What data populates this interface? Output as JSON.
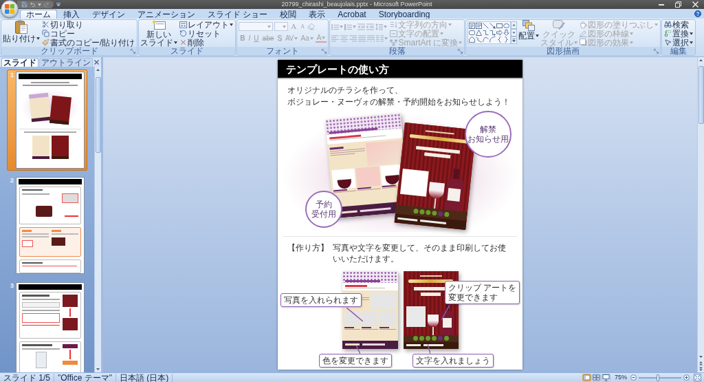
{
  "window": {
    "title": "20799_chirashi_beaujolais.pptx - Microsoft PowerPoint"
  },
  "ribbon_tabs": [
    {
      "label": "ホーム",
      "selected": true
    },
    {
      "label": "挿入",
      "selected": false
    },
    {
      "label": "デザイン",
      "selected": false
    },
    {
      "label": "アニメーション",
      "selected": false
    },
    {
      "label": "スライド ショー",
      "selected": false
    },
    {
      "label": "校閲",
      "selected": false
    },
    {
      "label": "表示",
      "selected": false
    },
    {
      "label": "Acrobat",
      "selected": false
    },
    {
      "label": "Storyboarding",
      "selected": false
    }
  ],
  "ribbon_groups": [
    {
      "kind": "clipboard",
      "label": "クリップボード",
      "launcher": true,
      "large": [
        {
          "lines": [
            "貼り付け"
          ],
          "disabled": false,
          "dropdown": true
        }
      ],
      "items": [
        {
          "label": "切り取り",
          "disabled": false
        },
        {
          "label": "コピー",
          "disabled": false
        },
        {
          "label": "書式のコピー/貼り付け",
          "disabled": false
        }
      ]
    },
    {
      "kind": "slides",
      "label": "スライド",
      "launcher": false,
      "large": [
        {
          "lines": [
            "新しい",
            "スライド"
          ],
          "disabled": false,
          "dropdown": true
        }
      ],
      "items": [
        {
          "label": "レイアウト",
          "disabled": false,
          "dropdown": true
        },
        {
          "label": "リセット",
          "disabled": false,
          "dropdown": false
        },
        {
          "label": "削除",
          "disabled": false,
          "dropdown": false
        }
      ]
    },
    {
      "kind": "font",
      "label": "フォント",
      "launcher": true,
      "disabled": true,
      "size_buttons": [
        "A",
        "A"
      ],
      "style_buttons": [
        "B",
        "I",
        "U",
        "abe",
        "S",
        "AV",
        "Aa",
        "A"
      ]
    },
    {
      "kind": "paragraph",
      "label": "段落",
      "launcher": true,
      "disabled": true,
      "items": [
        {
          "label": "文字列の方向",
          "disabled": true,
          "dropdown": true
        },
        {
          "label": "文字の配置",
          "disabled": true,
          "dropdown": true
        },
        {
          "label": "SmartArt に変換",
          "disabled": true,
          "dropdown": true
        }
      ]
    },
    {
      "kind": "drawing",
      "label": "図形描画",
      "launcher": true,
      "large": [
        {
          "lines": [
            "配置"
          ],
          "disabled": false,
          "dropdown": true
        },
        {
          "lines": [
            "クイック",
            "スタイル"
          ],
          "disabled": true,
          "dropdown": true
        }
      ],
      "items": [
        {
          "label": "図形の塗りつぶし",
          "disabled": true,
          "dropdown": true
        },
        {
          "label": "図形の枠線",
          "disabled": true,
          "dropdown": true
        },
        {
          "label": "図形の効果",
          "disabled": true,
          "dropdown": true
        }
      ]
    },
    {
      "kind": "editing",
      "label": "編集",
      "launcher": false,
      "items": [
        {
          "label": "検索",
          "disabled": false,
          "dropdown": false
        },
        {
          "label": "置換",
          "disabled": false,
          "dropdown": true
        },
        {
          "label": "選択",
          "disabled": false,
          "dropdown": true
        }
      ]
    }
  ],
  "panel_tabs": [
    {
      "label": "スライド",
      "selected": true
    },
    {
      "label": "アウトライン",
      "selected": false
    }
  ],
  "thumbnails": [
    {
      "number": "1",
      "kind": "flyers",
      "selected": true
    },
    {
      "number": "2",
      "kind": "photo_steps",
      "selected": false
    },
    {
      "number": "3",
      "kind": "clipart_steps",
      "selected": false
    }
  ],
  "slide": {
    "title": "テンプレートの使い方",
    "lead": [
      "オリジナルのチラシを作って、",
      "ボジョレー・ヌーヴォの解禁・予約開始をお知らせしよう！"
    ],
    "badges": [
      {
        "lines": [
          "解禁",
          "お知らせ用"
        ]
      },
      {
        "lines": [
          "予約",
          "受付用"
        ]
      }
    ],
    "how_to": {
      "label": "【作り方】",
      "text": "写真や文字を変更して、そのまま印刷してお使いいただけます。"
    },
    "callouts": [
      {
        "lines": [
          "写真を入れられます"
        ]
      },
      {
        "lines": [
          "クリップ アートを",
          "変更できます"
        ]
      },
      {
        "lines": [
          "色を変更できます"
        ]
      },
      {
        "lines": [
          "文字を入れましょう"
        ]
      }
    ]
  },
  "status_bar": {
    "items": [
      "スライド 1/5",
      "\"Office テーマ\"",
      "日本語 (日本)"
    ],
    "views": [
      {
        "kind": "normal",
        "selected": true
      },
      {
        "kind": "sorter",
        "selected": false
      },
      {
        "kind": "show",
        "selected": false
      }
    ],
    "zoom": "75%",
    "zoom_slider": {
      "level": 0.45
    }
  }
}
